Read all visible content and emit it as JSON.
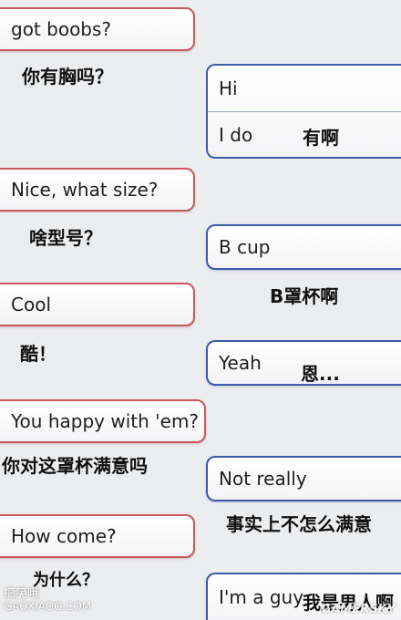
{
  "messages_them": [
    {
      "text": "got boobs?",
      "translation": "你有胸吗？"
    },
    {
      "text": "Nice, what size?",
      "translation": "啥型号？"
    },
    {
      "text": "Cool",
      "translation": "酷！"
    },
    {
      "text": "You happy with 'em?",
      "translation": "你对这罩杯满意吗"
    },
    {
      "text": "How come?",
      "translation": "为什么？"
    }
  ],
  "messages_me": [
    {
      "text": "Hi",
      "translation": ""
    },
    {
      "text": "I do",
      "translation": "有啊"
    },
    {
      "text": "B cup",
      "translation": "B罩杯啊"
    },
    {
      "text": "Yeah",
      "translation": "恩..."
    },
    {
      "text": "Not really",
      "translation": "事实上不怎么满意"
    },
    {
      "text": "I'm a guy",
      "translation": "我是男人啊"
    }
  ],
  "watermark": {
    "site_cn": "搞笑哦",
    "site_url": "GAOXIAOO.COM",
    "logo": "GAMERSKY"
  },
  "colors": {
    "them_border": "#c9595c",
    "me_border": "#3e5aa8",
    "background": "#ecedef"
  }
}
